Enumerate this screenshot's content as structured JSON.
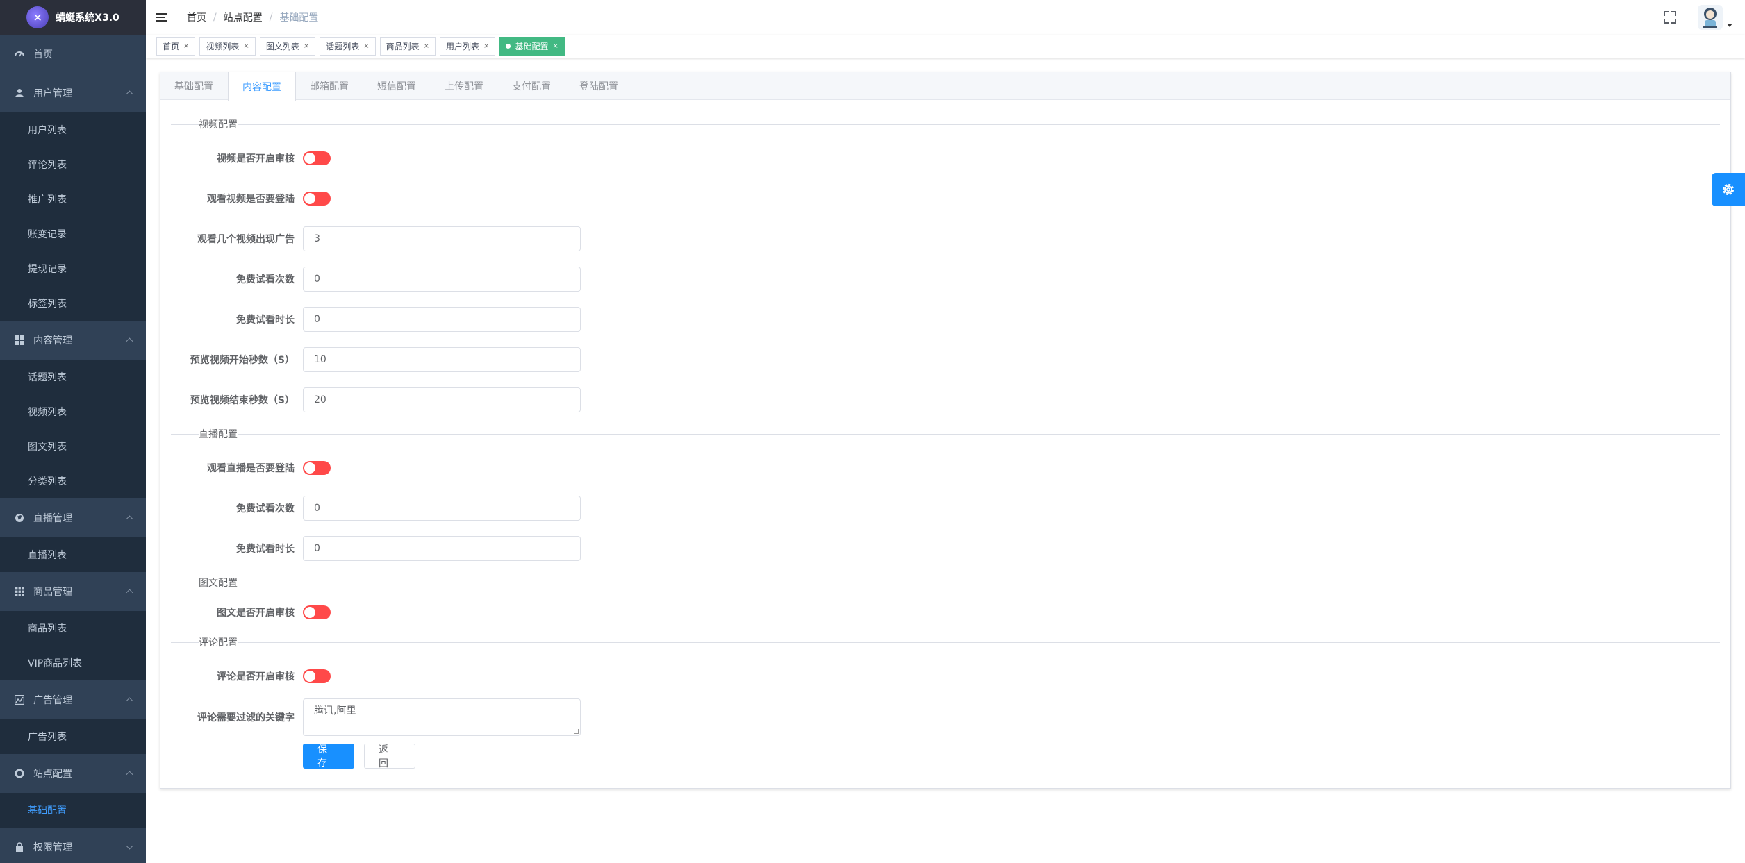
{
  "app": {
    "title": "蜻蜓系统X3.0"
  },
  "sidebar": {
    "home": "首页",
    "groups": [
      {
        "label": "用户管理",
        "icon": "user-icon",
        "items": [
          "用户列表",
          "评论列表",
          "推广列表",
          "账变记录",
          "提现记录",
          "标签列表"
        ]
      },
      {
        "label": "内容管理",
        "icon": "grid-icon",
        "items": [
          "话题列表",
          "视频列表",
          "图文列表",
          "分类列表"
        ]
      },
      {
        "label": "直播管理",
        "icon": "globe-icon",
        "items": [
          "直播列表"
        ]
      },
      {
        "label": "商品管理",
        "icon": "table-icon",
        "items": [
          "商品列表",
          "VIP商品列表"
        ]
      },
      {
        "label": "广告管理",
        "icon": "chart-icon",
        "items": [
          "广告列表"
        ]
      },
      {
        "label": "站点配置",
        "icon": "lifebuoy-icon",
        "items": [
          "基础配置"
        ]
      },
      {
        "label": "权限管理",
        "icon": "lock-icon",
        "items": []
      }
    ]
  },
  "breadcrumb": [
    "首页",
    "站点配置",
    "基础配置"
  ],
  "tags": [
    "首页",
    "视频列表",
    "图文列表",
    "话题列表",
    "商品列表",
    "用户列表"
  ],
  "active_tag": "基础配置",
  "tabs": [
    "基础配置",
    "内容配置",
    "邮箱配置",
    "短信配置",
    "上传配置",
    "支付配置",
    "登陆配置"
  ],
  "form": {
    "video_section": "视频配置",
    "video_audit": "视频是否开启审核",
    "video_login": "观看视频是否要登陆",
    "ad_count_label": "观看几个视频出现广告",
    "ad_count_value": "3",
    "free_times_label": "免费试看次数",
    "free_times_value": "0",
    "free_duration_label": "免费试看时长",
    "free_duration_value": "0",
    "preview_start_label": "预览视频开始秒数（S）",
    "preview_start_value": "10",
    "preview_end_label": "预览视频结束秒数（S）",
    "preview_end_value": "20",
    "live_section": "直播配置",
    "live_login": "观看直播是否要登陆",
    "live_free_times_label": "免费试看次数",
    "live_free_times_value": "0",
    "live_free_duration_label": "免费试看时长",
    "live_free_duration_value": "0",
    "article_section": "图文配置",
    "article_audit": "图文是否开启审核",
    "comment_section": "评论配置",
    "comment_audit": "评论是否开启审核",
    "keywords_label": "评论需要过滤的关键字",
    "keywords_value": "腾讯,阿里",
    "save": "保 存",
    "back": "返 回"
  }
}
